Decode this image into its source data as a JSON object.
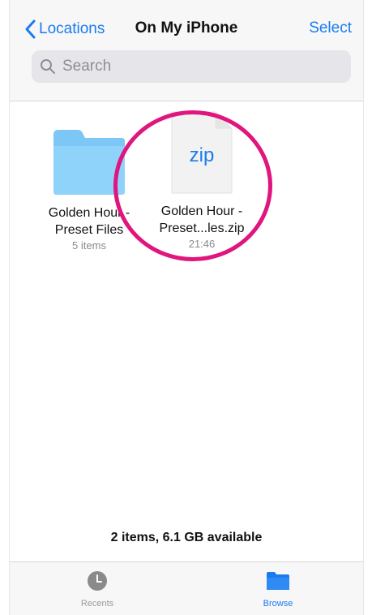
{
  "header": {
    "back_label": "Locations",
    "title": "On My iPhone",
    "select_label": "Select"
  },
  "search": {
    "placeholder": "Search",
    "icon": "search-icon"
  },
  "files": [
    {
      "type": "folder",
      "icon": "folder-icon",
      "name_line1": "Golden Hour -",
      "name_line2": "Preset Files",
      "meta": "5 items"
    },
    {
      "type": "zip",
      "icon": "zip-file-icon",
      "badge": "zip",
      "name_line1": "Golden Hour -",
      "name_line2": "Preset...les.zip",
      "meta": "21:46"
    }
  ],
  "status": "2 items, 6.1 GB available",
  "tabs": [
    {
      "label": "Recents",
      "icon": "clock-icon",
      "active": false
    },
    {
      "label": "Browse",
      "icon": "folder-icon",
      "active": true
    }
  ],
  "colors": {
    "accent": "#1a7cf0",
    "highlight": "#e0157d",
    "folder": "#7cc7f6"
  }
}
